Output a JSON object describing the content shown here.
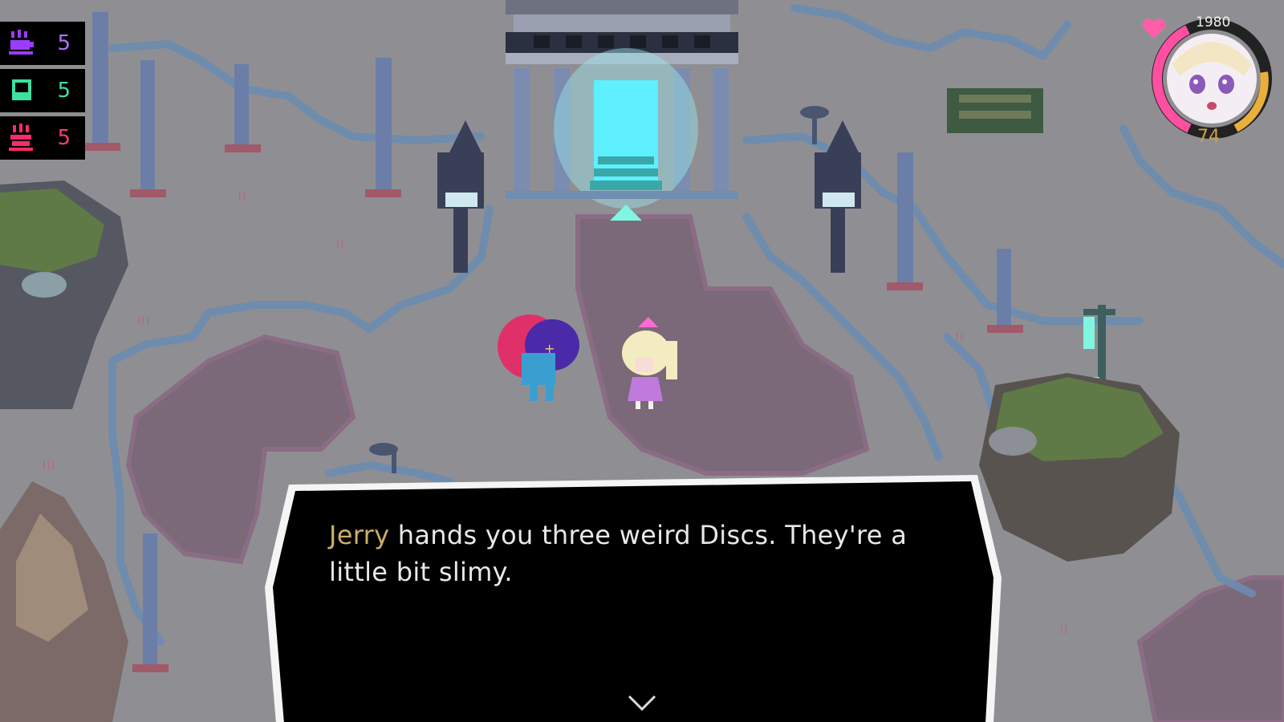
{
  "hud": {
    "items": [
      {
        "icon": "purple-cup-icon",
        "count": "5",
        "color": "#9a3cff"
      },
      {
        "icon": "green-cup-icon",
        "count": "5",
        "color": "#3ee0a0"
      },
      {
        "icon": "red-cup-icon",
        "count": "5",
        "color": "#ff2a6a"
      }
    ]
  },
  "player": {
    "score": "1980",
    "hp": "74",
    "heart_color": "#ff5fa8",
    "ring_pink": "#ff4fa0",
    "ring_gold": "#e8b03a"
  },
  "dialog": {
    "speaker": "Jerry",
    "text": " hands you three weird Discs. They're a little bit slimy.",
    "advance_icon": "chevron-down-icon"
  },
  "colors": {
    "ground": "#8f8f93",
    "path": "#7a6676",
    "rock_edge": "#6f8eb0",
    "portal": "#5ff0ff",
    "speaker": "#c9ae6a"
  }
}
